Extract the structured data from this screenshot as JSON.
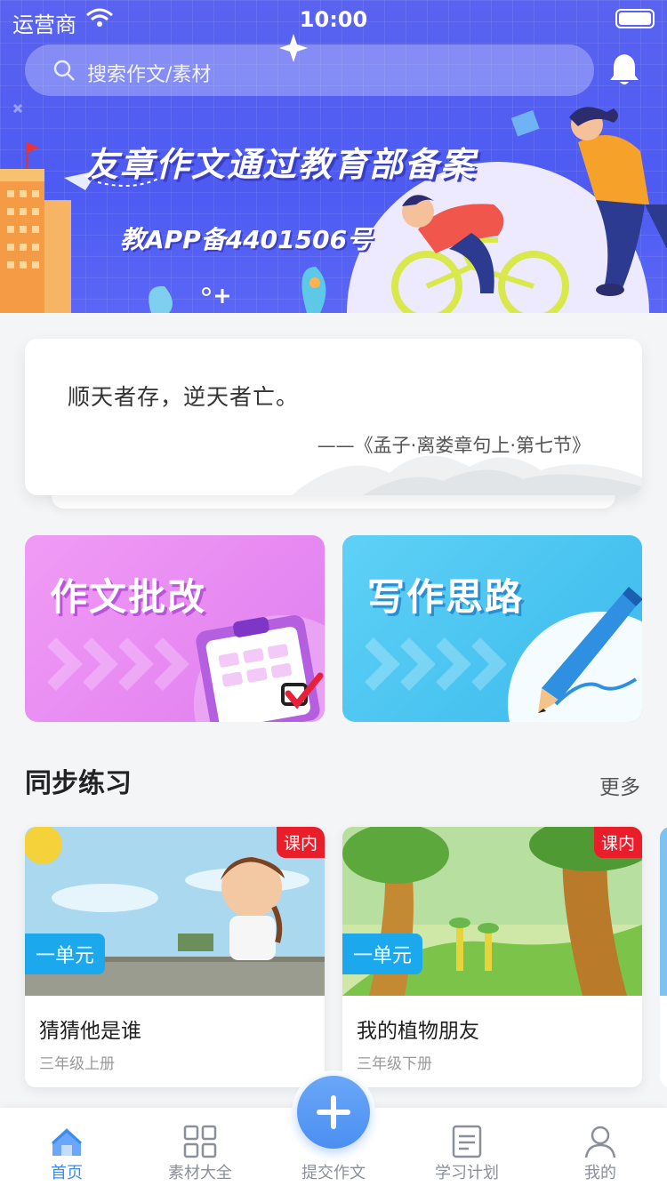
{
  "status_bar": {
    "carrier": "运营商",
    "time": "10:00"
  },
  "search": {
    "placeholder": "搜索作文/素材"
  },
  "banner": {
    "title": "友章作文通过教育部备案",
    "subtitle": "教APP备4401506号"
  },
  "quote": {
    "text": "顺天者存，逆天者亡。",
    "source": "——《孟子·离娄章句上·第七节》"
  },
  "features": [
    {
      "label": "作文批改"
    },
    {
      "label": "写作思路"
    }
  ],
  "section": {
    "title": "同步练习",
    "more": "更多"
  },
  "lessons": [
    {
      "badge": "课内",
      "unit": "一单元",
      "title": "猜猜他是谁",
      "grade": "三年级上册"
    },
    {
      "badge": "课内",
      "unit": "一单元",
      "title": "我的植物朋友",
      "grade": "三年级下册"
    }
  ],
  "tabbar": {
    "items": [
      {
        "label": "首页",
        "icon": "home-icon",
        "active": true
      },
      {
        "label": "素材大全",
        "icon": "grid-icon"
      },
      {
        "label": "提交作文",
        "icon": "plus-icon"
      },
      {
        "label": "学习计划",
        "icon": "plan-icon"
      },
      {
        "label": "我的",
        "icon": "user-icon"
      }
    ]
  },
  "colors": {
    "accent": "#3b8cf0",
    "banner": "#4d5bf3",
    "badge": "#ea1e2b",
    "unit_tag": "#1ba8ec"
  }
}
